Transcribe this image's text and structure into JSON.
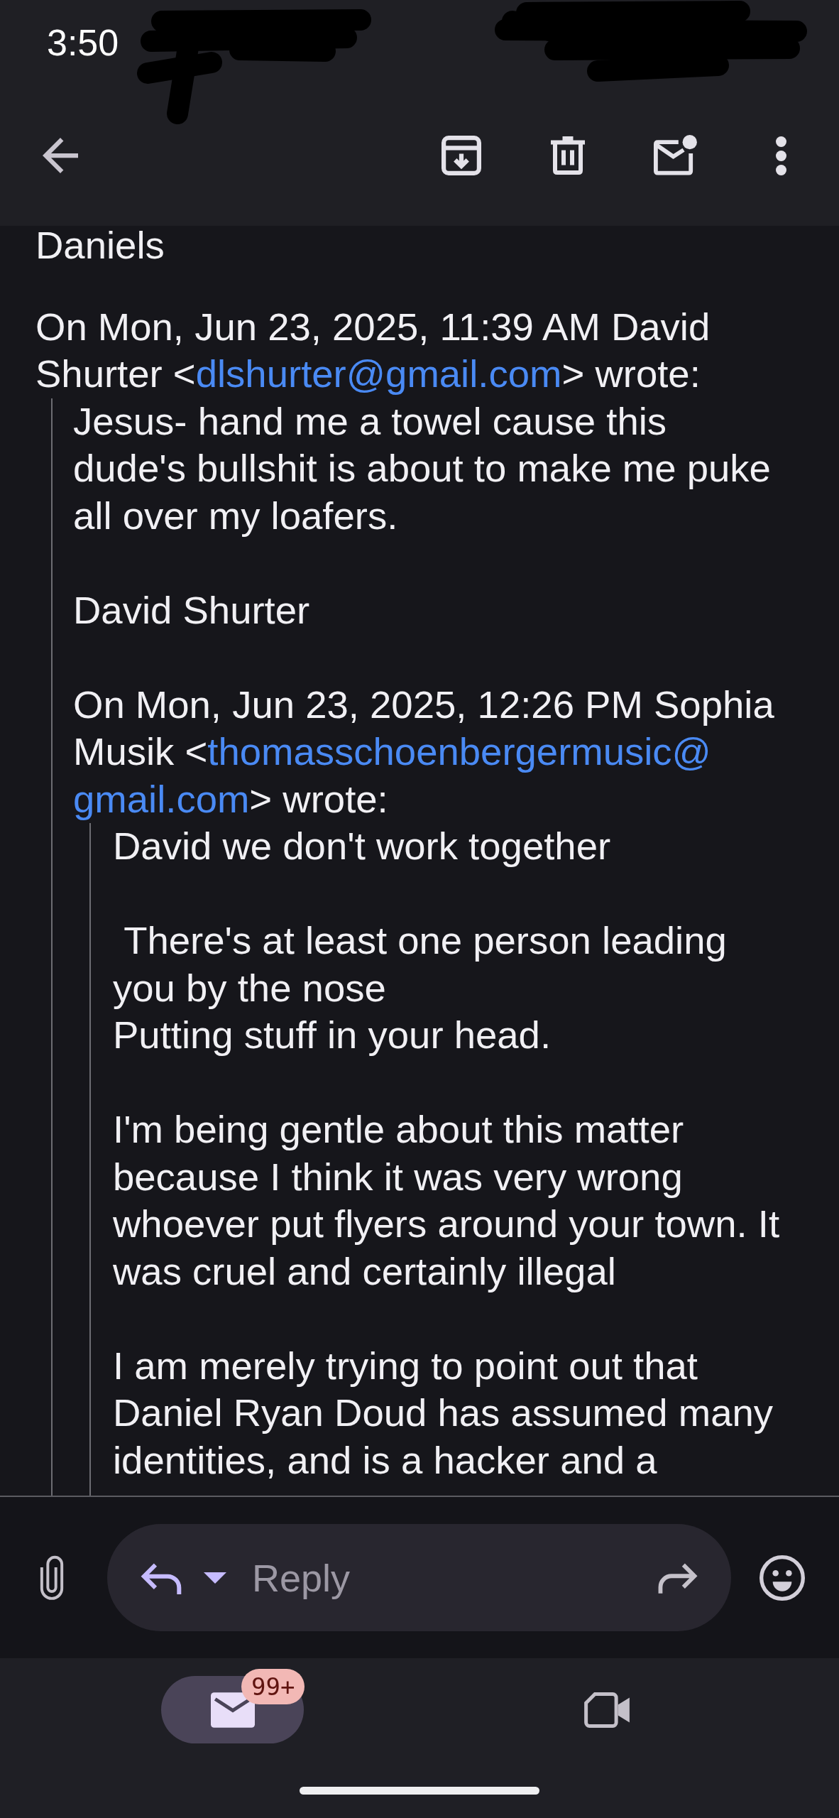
{
  "status_bar": {
    "time": "3:50"
  },
  "message": {
    "blocks": [
      {
        "kind": "paragraph",
        "text": "Daniels"
      },
      {
        "kind": "attribution",
        "text": "On Mon, Jun 23, 2025, 11:39 AM David\nShurter <",
        "email": [
          "dlshurter@gmail.com"
        ],
        "after": "> wrote:"
      },
      {
        "kind": "quote",
        "children": [
          {
            "kind": "paragraph",
            "text": "Jesus- hand me a towel cause this\ndude's bullshit is about to make me puke\nall over my loafers."
          },
          {
            "kind": "paragraph",
            "text": "David Shurter"
          },
          {
            "kind": "attribution",
            "text": "On Mon, Jun 23, 2025, 12:26 PM Sophia\nMusik <",
            "email": [
              "thomasschoenbergermusic@",
              "gmail.com"
            ],
            "after": "> wrote:"
          },
          {
            "kind": "quote",
            "children": [
              {
                "kind": "paragraph",
                "text": "David we don't work together"
              },
              {
                "kind": "paragraph",
                "text": " There's at least one person leading\nyou by the nose\nPutting stuff in your head."
              },
              {
                "kind": "paragraph",
                "text": "I'm being gentle about this matter\nbecause I think it was very wrong\nwhoever put flyers around your town. It\nwas cruel and certainly illegal"
              },
              {
                "kind": "paragraph",
                "text": "I am merely trying to point out that\nDaniel Ryan Doud has assumed many\nidentities, and is a hacker and a"
              }
            ]
          }
        ]
      }
    ]
  },
  "reply_bar": {
    "placeholder": "Reply"
  },
  "bottom_nav": {
    "items": [
      {
        "kind": "mail",
        "selected": true,
        "badge": "99+"
      },
      {
        "kind": "video",
        "selected": false
      }
    ]
  }
}
